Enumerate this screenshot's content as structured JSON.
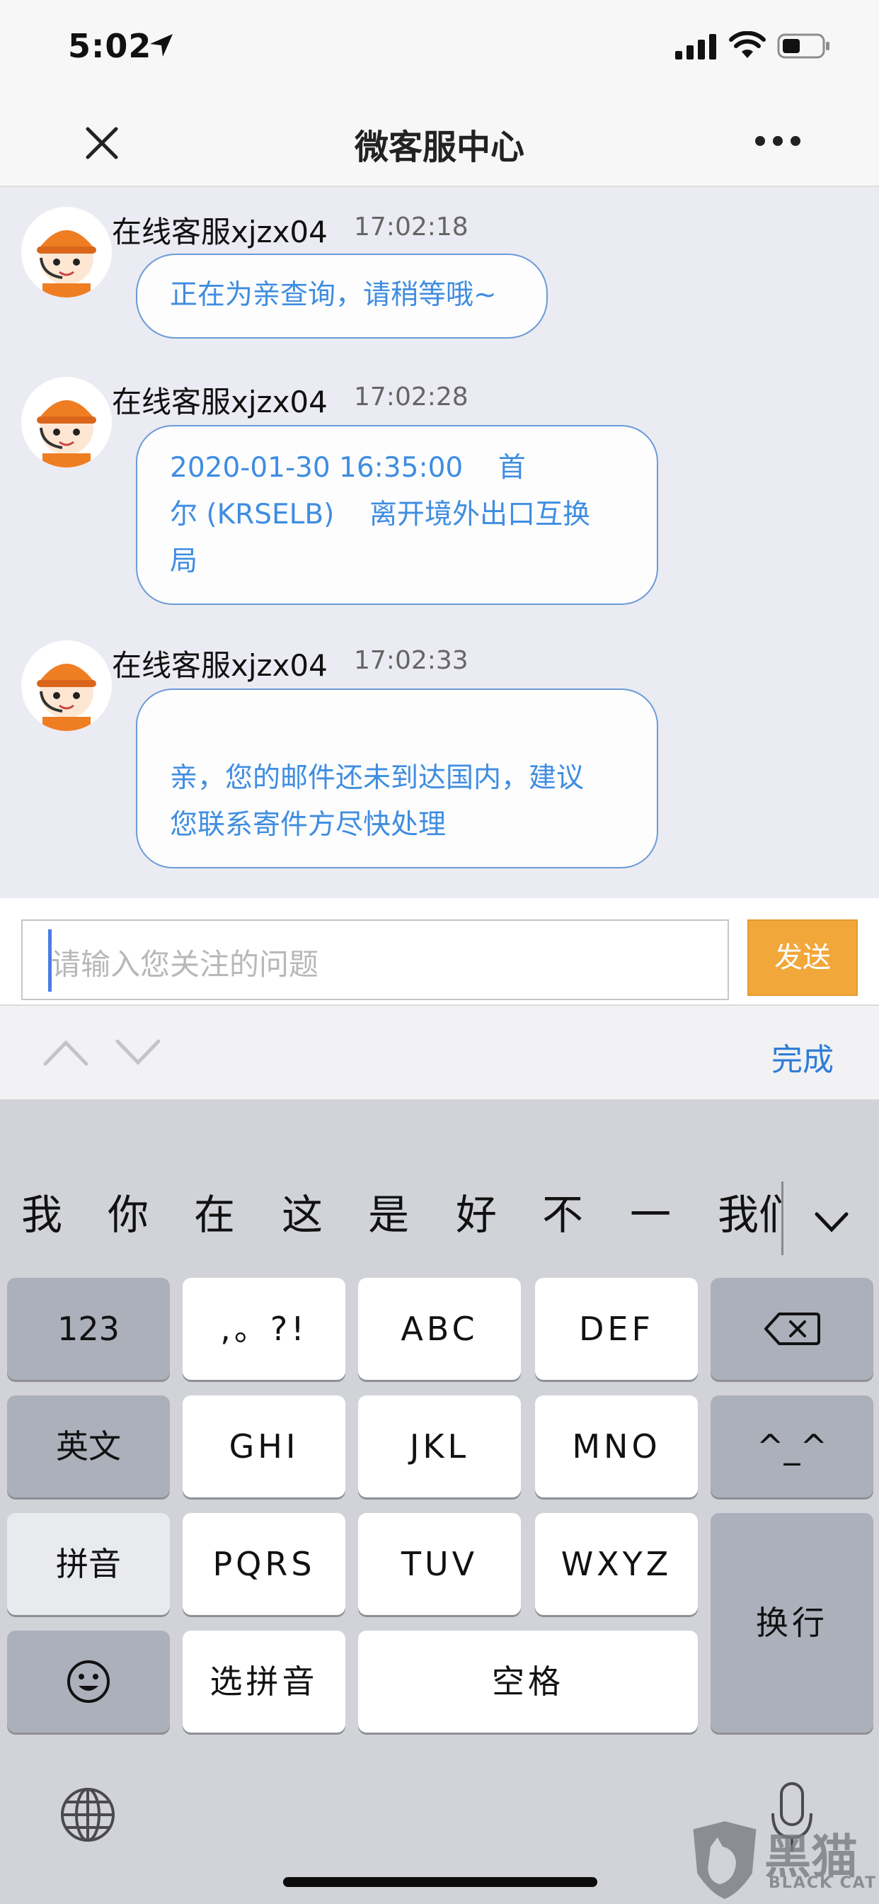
{
  "status_bar": {
    "time": "5:02"
  },
  "nav": {
    "title": "微客服中心"
  },
  "messages": [
    {
      "sender": "在线客服xjzx04",
      "time": "17:02:18",
      "lines": [
        "正在为亲查询，请稍等哦~"
      ]
    },
    {
      "sender": "在线客服xjzx04",
      "time": "17:02:28",
      "lines": [
        "2020-01-30 16:35:00    首",
        "尔 (KRSELB)    离开境外出口互换",
        "局"
      ]
    },
    {
      "sender": "在线客服xjzx04",
      "time": "17:02:33",
      "lines": [
        "",
        "亲，您的邮件还未到达国内，建议",
        "您联系寄件方尽快处理"
      ]
    }
  ],
  "input": {
    "placeholder": "请输入您关注的问题",
    "send_label": "发送"
  },
  "accessory": {
    "done_label": "完成"
  },
  "keyboard": {
    "candidates": [
      "我",
      "你",
      "在",
      "这",
      "是",
      "好",
      "不",
      "一",
      "我们"
    ],
    "keys": {
      "num": "123",
      "punct": ",。?!",
      "abc": "ABC",
      "def": "DEF",
      "english": "英文",
      "ghi": "GHI",
      "jkl": "JKL",
      "mno": "MNO",
      "emoticon": "^_^",
      "pinyin": "拼音",
      "pqrs": "PQRS",
      "tuv": "TUV",
      "wxyz": "WXYZ",
      "newline": "换行",
      "select_pinyin": "选拼音",
      "space": "空格"
    }
  },
  "watermark": {
    "cn": "黑猫",
    "en": "BLACK CAT"
  },
  "colors": {
    "accent": "#f2a73b",
    "bubble_text": "#3f8de0",
    "link": "#2f7cd6"
  }
}
